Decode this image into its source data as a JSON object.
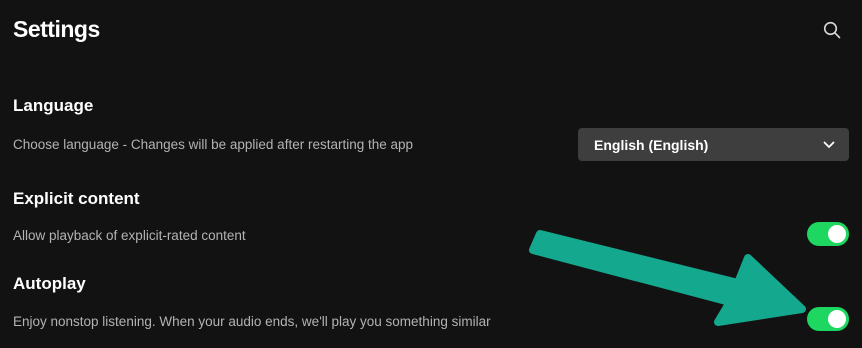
{
  "header": {
    "title": "Settings",
    "search_icon": "search-icon"
  },
  "language": {
    "title": "Language",
    "description": "Choose language - Changes will be applied after restarting the app",
    "selected": "English (English)",
    "dropdown_icon": "chevron-down-icon"
  },
  "explicit": {
    "title": "Explicit content",
    "description": "Allow playback of explicit-rated content",
    "enabled": true
  },
  "autoplay": {
    "title": "Autoplay",
    "description": "Enjoy nonstop listening. When your audio ends, we'll play you something similar",
    "enabled": true
  },
  "colors": {
    "background": "#121212",
    "toggle_on": "#1ed760",
    "annotation_arrow": "#14a88e"
  }
}
